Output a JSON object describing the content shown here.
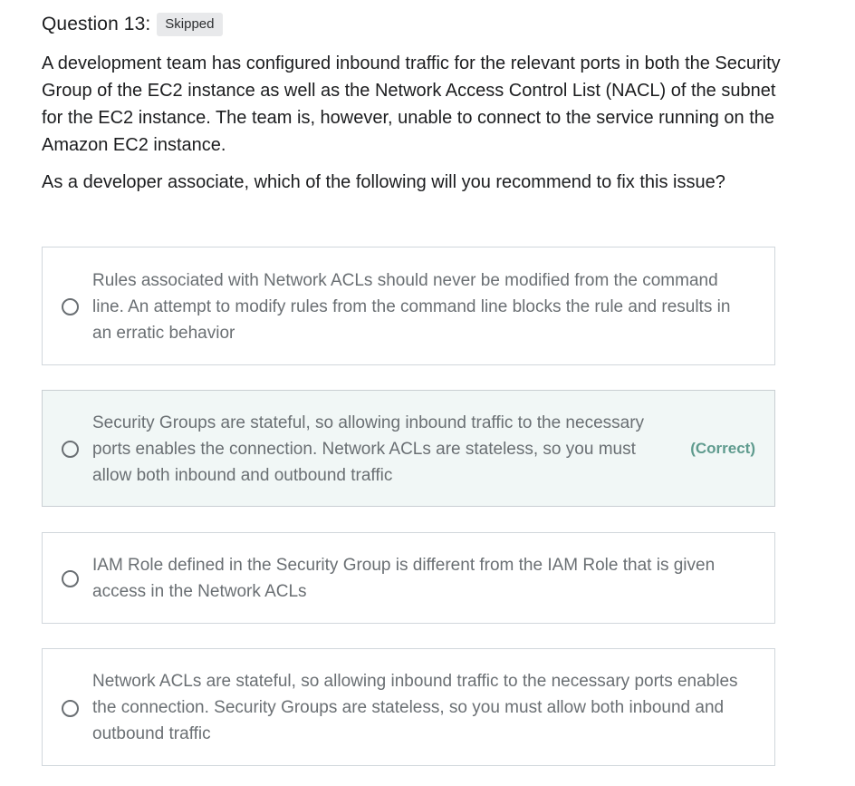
{
  "question": {
    "title": "Question 13:",
    "badge": "Skipped",
    "paragraphs": [
      "A development team has configured inbound traffic for the relevant ports in both the Security Group of the EC2 instance as well as the Network Access Control List (NACL) of the subnet for the EC2 instance. The team is, however, unable to connect to the service running on the Amazon EC2 instance.",
      "As a developer associate, which of the following will you recommend to fix this issue?"
    ]
  },
  "answers": [
    {
      "text": "Rules associated with Network ACLs should never be modified from the command line. An attempt to modify rules from the command line blocks the rule and results in an erratic behavior",
      "correct": false
    },
    {
      "text": "Security Groups are stateful, so allowing inbound traffic to the necessary ports enables the connection. Network ACLs are stateless, so you must allow both inbound and outbound traffic",
      "correct": true,
      "tag": "(Correct)"
    },
    {
      "text": "IAM Role defined in the Security Group is different from the IAM Role that is given access in the Network ACLs",
      "correct": false
    },
    {
      "text": "Network ACLs are stateful, so allowing inbound traffic to the necessary ports enables the connection. Security Groups are stateless, so you must allow both inbound and outbound traffic",
      "correct": false
    }
  ],
  "colors": {
    "correct_bg": "#f1f7f6",
    "correct_text": "#5f9b8e",
    "option_text": "#6a6f73",
    "border": "#d1d7dc"
  }
}
